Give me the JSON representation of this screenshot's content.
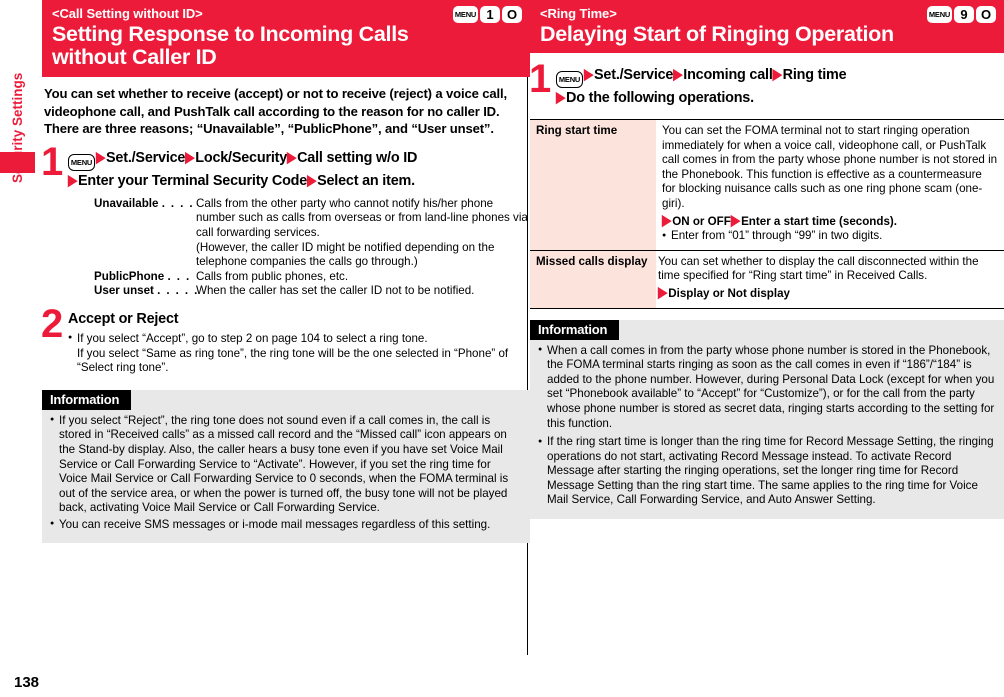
{
  "sidebar": {
    "tab_label": "Security Settings",
    "accent_color": "#ed1b3a"
  },
  "page_number": "138",
  "left_column": {
    "banner": {
      "subtitle": "<Call Setting without ID>",
      "title_line1": "Setting Response to Incoming Calls",
      "title_line2": "without Caller ID",
      "keys": [
        "MENU",
        "1",
        "O"
      ]
    },
    "intro": "You can set whether to receive (accept) or not to receive (reject) a voice call, videophone call, and PushTalk call according to the reason for no caller ID. There are three reasons; “Unavailable”, “PublicPhone”, and “User unset”.",
    "step1": {
      "number": "1",
      "menu_key": "MENU",
      "seq_line1": [
        "Set./Service",
        "Lock/Security",
        "Call setting w/o ID"
      ],
      "seq_line2": [
        "Enter your Terminal Security Code",
        "Select an item."
      ],
      "definitions": [
        {
          "term": "Unavailable",
          "dots": ". . . .",
          "desc": "Calls from the other party who cannot notify his/her phone number such as calls from overseas or from land-line phones via call forwarding services.\n(However, the caller ID might be notified depending on the telephone companies the calls go through.)"
        },
        {
          "term": "PublicPhone",
          "dots": ". . .",
          "desc": "Calls from public phones, etc."
        },
        {
          "term": "User unset",
          "dots": ". . . . .",
          "desc": "When the caller has set the caller ID not to be notified."
        }
      ]
    },
    "step2": {
      "number": "2",
      "heading": "Accept or Reject",
      "bullet1_line1": "If you select “Accept”, go to step 2 on page 104 to select a ring tone.",
      "bullet1_line2": "If you select “Same as ring tone”, the ring tone will be the one selected in “Phone” of “Select ring tone”."
    },
    "information": {
      "heading": "Information",
      "items": [
        "If you select “Reject”, the ring tone does not sound even if a call comes in, the call is stored in “Received calls” as a missed call record and the “Missed call” icon appears on the Stand-by display. Also, the caller hears a busy tone even if you have set Voice Mail Service or Call Forwarding Service to “Activate”. However, if you set the ring time for Voice Mail Service or Call Forwarding Service to 0 seconds, when the FOMA terminal is out of the service area, or when the power is turned off, the busy tone will not be played back, activating Voice Mail Service or Call Forwarding Service.",
        "You can receive SMS messages or i-mode mail messages regardless of this setting."
      ]
    }
  },
  "right_column": {
    "banner": {
      "subtitle": "<Ring Time>",
      "title_line1": "Delaying Start of Ringing Operation",
      "keys": [
        "MENU",
        "9",
        "O"
      ]
    },
    "step1": {
      "number": "1",
      "menu_key": "MENU",
      "seq_line1": [
        "Set./Service",
        "Incoming call",
        "Ring time"
      ],
      "seq_line2": [
        "Do the following operations."
      ]
    },
    "table": {
      "rows": [
        {
          "term": "Ring start time",
          "desc": "You can set the FOMA terminal not to start ringing operation immediately for when a voice call, videophone call, or PushTalk call comes in from the party whose phone number is not stored in the Phonebook. This function is effective as a countermeasure for blocking nuisance calls such as one ring phone scam (one-giri).",
          "options_line": [
            "ON or OFF",
            "Enter a start time (seconds)."
          ],
          "note": "Enter from “01” through “99” in two digits."
        },
        {
          "term": "Missed calls display",
          "desc": "You can set whether to display the call disconnected within the time specified for “Ring start time” in Received Calls.",
          "options_line": [
            "Display or Not display"
          ],
          "note": ""
        }
      ]
    },
    "information": {
      "heading": "Information",
      "items": [
        "When a call comes in from the party whose phone number is stored in the Phonebook, the FOMA terminal starts ringing as soon as the call comes in even if “186”/“184” is added to the phone number. However, during Personal Data Lock (except for when you set “Phonebook available” to “Accept” for “Customize”), or for the call from the party whose phone number is stored as secret data, ringing starts according to the setting for this function.",
        "If the ring start time is longer than the ring time for Record Message Setting, the ringing operations do not start, activating Record Message instead. To activate Record Message after starting the ringing operations, set the longer ring time for Record Message Setting than the ring start time. The same applies to the ring time for Voice Mail Service, Call Forwarding Service, and Auto Answer Setting."
      ]
    }
  }
}
